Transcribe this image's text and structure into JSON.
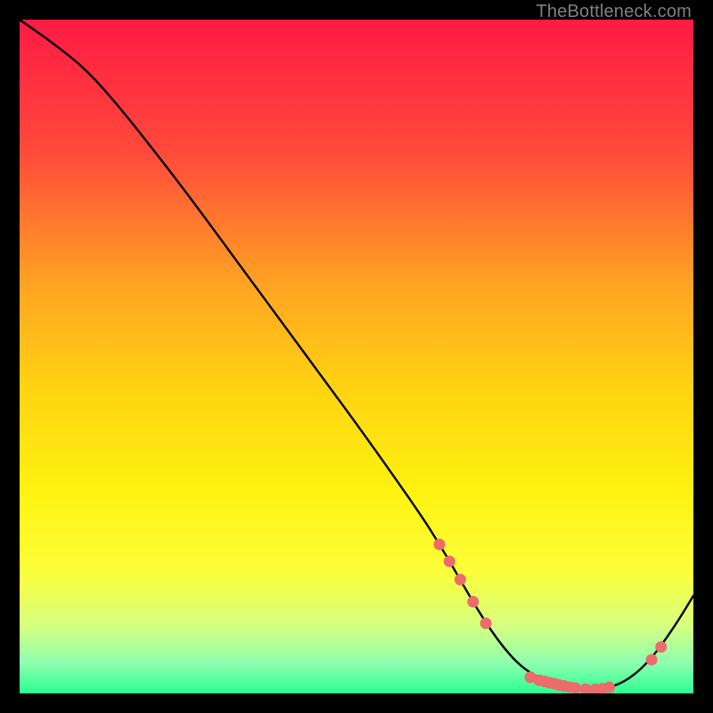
{
  "watermark": "TheBottleneck.com",
  "chart_data": {
    "type": "line",
    "title": "",
    "xlabel": "",
    "ylabel": "",
    "xlim": [
      0,
      100
    ],
    "ylim": [
      0,
      100
    ],
    "gradient_stops": [
      {
        "offset": 0.0,
        "color": "#ff1a44"
      },
      {
        "offset": 0.2,
        "color": "#ff4b3a"
      },
      {
        "offset": 0.4,
        "color": "#ffa621"
      },
      {
        "offset": 0.55,
        "color": "#ffd412"
      },
      {
        "offset": 0.7,
        "color": "#fff210"
      },
      {
        "offset": 0.82,
        "color": "#fbff3a"
      },
      {
        "offset": 0.9,
        "color": "#d6ff80"
      },
      {
        "offset": 0.955,
        "color": "#8dffb0"
      },
      {
        "offset": 1.0,
        "color": "#2bff8f"
      }
    ],
    "series": [
      {
        "name": "bottleneck-curve",
        "x": [
          0,
          5,
          10,
          15,
          20,
          25,
          30,
          35,
          40,
          45,
          50,
          55,
          60,
          62,
          64,
          66,
          68,
          70,
          72,
          74,
          76,
          78,
          80,
          82,
          84,
          86,
          88,
          90,
          92,
          94,
          96,
          98,
          100
        ],
        "y": [
          100,
          96.5,
          92.5,
          86.8,
          80.5,
          74.0,
          67.2,
          60.4,
          53.6,
          46.8,
          40.0,
          33.0,
          25.8,
          22.6,
          19.3,
          15.8,
          12.4,
          9.3,
          6.6,
          4.4,
          2.9,
          1.8,
          1.1,
          0.7,
          0.55,
          0.6,
          1.0,
          1.9,
          3.4,
          5.5,
          8.2,
          11.2,
          14.5
        ]
      }
    ],
    "markers": {
      "name": "highlight-dots",
      "color": "#ec6b6b",
      "points": [
        {
          "x": 62.3,
          "y": 22.1
        },
        {
          "x": 63.8,
          "y": 19.6
        },
        {
          "x": 65.4,
          "y": 16.9
        },
        {
          "x": 67.3,
          "y": 13.6
        },
        {
          "x": 69.2,
          "y": 10.4
        },
        {
          "x": 75.8,
          "y": 2.4
        },
        {
          "x": 77.1,
          "y": 1.95
        },
        {
          "x": 77.9,
          "y": 1.77
        },
        {
          "x": 78.6,
          "y": 1.6
        },
        {
          "x": 79.3,
          "y": 1.45
        },
        {
          "x": 80.0,
          "y": 1.25
        },
        {
          "x": 80.8,
          "y": 1.1
        },
        {
          "x": 81.6,
          "y": 0.95
        },
        {
          "x": 82.5,
          "y": 0.8
        },
        {
          "x": 84.0,
          "y": 0.63
        },
        {
          "x": 85.4,
          "y": 0.6
        },
        {
          "x": 86.5,
          "y": 0.7
        },
        {
          "x": 87.5,
          "y": 0.9
        },
        {
          "x": 93.8,
          "y": 5.0
        },
        {
          "x": 95.2,
          "y": 6.9
        }
      ]
    }
  }
}
